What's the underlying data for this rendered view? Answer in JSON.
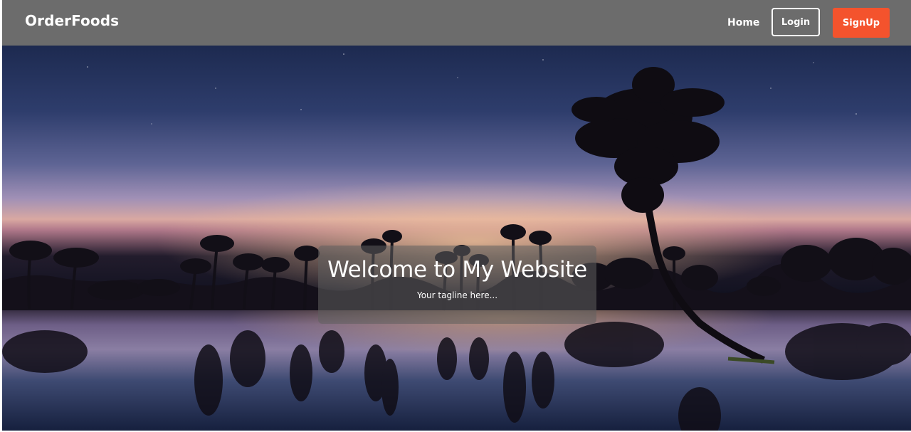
{
  "navbar": {
    "brand": "OrderFoods",
    "home_label": "Home",
    "login_label": "Login",
    "signup_label": "SignUp"
  },
  "hero": {
    "title": "Welcome to My Website",
    "tagline": "Your tagline here...",
    "background_image": "night-lake-palm-trees"
  },
  "colors": {
    "navbar_bg": "#6c6c6c",
    "signup_bg": "#f4532d",
    "text": "#ffffff"
  }
}
